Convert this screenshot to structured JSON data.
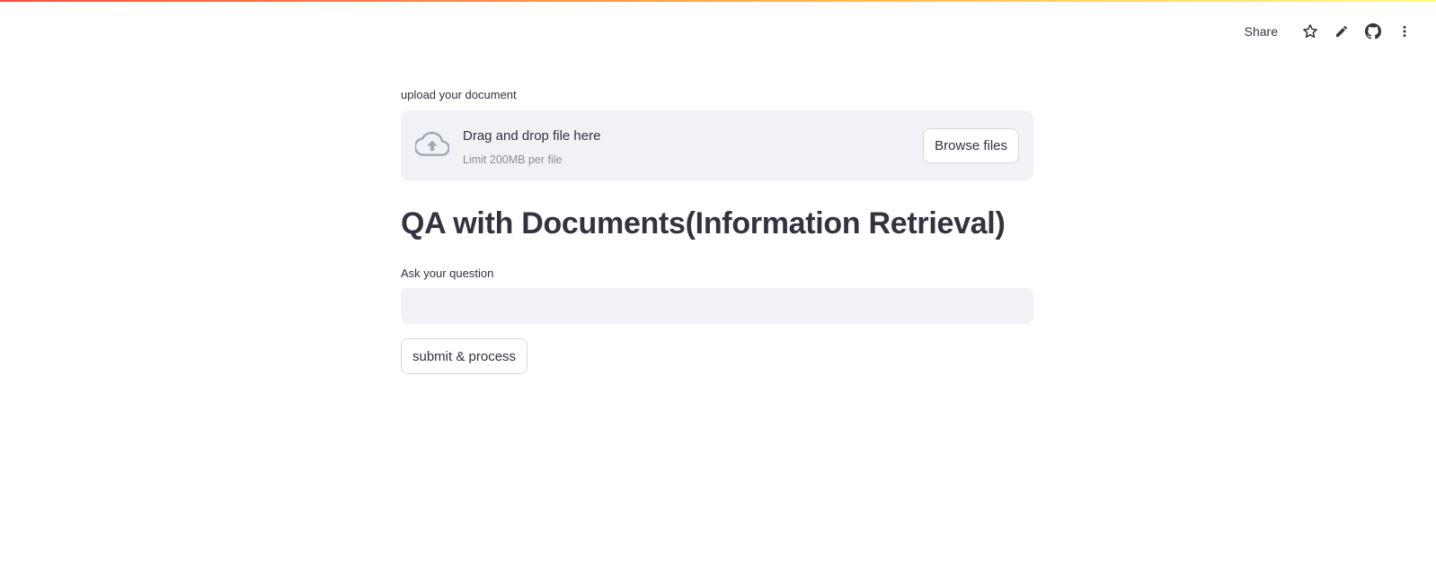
{
  "header": {
    "share_label": "Share",
    "icons": [
      "star-icon",
      "pencil-icon",
      "github-icon",
      "more-vertical-icon"
    ]
  },
  "uploader": {
    "label": "upload your document",
    "drop_text": "Drag and drop file here",
    "limit_text": "Limit 200MB per file",
    "browse_label": "Browse files",
    "icon": "cloud-upload-icon"
  },
  "page": {
    "title": "QA with Documents(Information Retrieval)"
  },
  "question": {
    "label": "Ask your question",
    "value": "",
    "placeholder": ""
  },
  "submit": {
    "label": "submit & process"
  },
  "colors": {
    "text": "#31333f",
    "muted": "#8a8d98",
    "input_bg": "#f0f2f6",
    "icon_blue_gray": "#a3a8b8",
    "border": "#d5d8de",
    "accent_red": "#ff4b4b",
    "accent_yellow": "#ffbd45"
  }
}
